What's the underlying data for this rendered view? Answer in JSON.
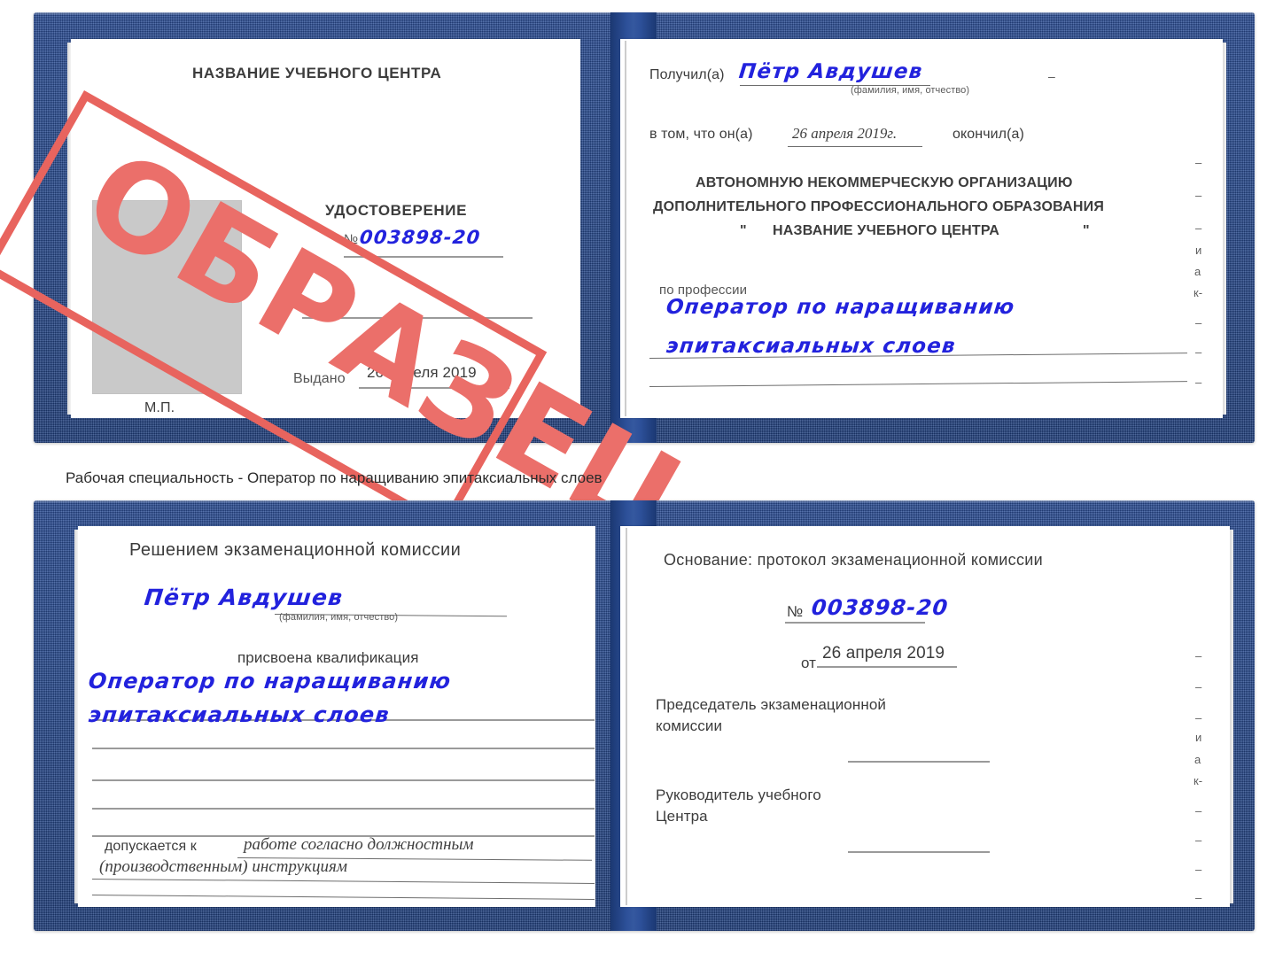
{
  "caption": "Рабочая специальность - Оператор по наращиванию эпитаксиальных слоев",
  "colors": {
    "cover_blue": "#274990",
    "spine_blue": "#1b3872",
    "ink_blue": "#2222dd",
    "stamp_red": "#e8645e",
    "rule_gray": "#9a9a9a",
    "photo_gray": "#c9c9c9"
  },
  "watermark": {
    "text": "ОБРАЗЕЦ",
    "name": "sample-watermark-stamp"
  },
  "certificate_top": {
    "name": "udostoverenie-spread",
    "left_page": {
      "org_title": "НАЗВАНИЕ УЧЕБНОГО ЦЕНТРА",
      "doc_type": "УДОСТОВЕРЕНИЕ",
      "number_label": "№",
      "number_value": "003898-20",
      "issued_label": "Выдано",
      "issued_value": "26 апреля 2019",
      "seal_label": "М.П.",
      "photo_placeholder": "photo-placeholder"
    },
    "right_page": {
      "received_label": "Получил(а)",
      "received_value": "Пётр Авдушев",
      "fio_hint": "(фамилия, имя, отчество)",
      "in_that_label": "в том, что он(а)",
      "completion_date": "26 апреля 2019г.",
      "finished_label": "окончил(а)",
      "org_line1": "АВТОНОМНУЮ НЕКОММЕРЧЕСКУЮ ОРГАНИЗАЦИЮ",
      "org_line2": "ДОПОЛНИТЕЛЬНОГО ПРОФЕССИОНАЛЬНОГО ОБРАЗОВАНИЯ",
      "org_quote_open": "\"",
      "org_line3": "НАЗВАНИЕ УЧЕБНОГО ЦЕНТРА",
      "org_quote_close": "\"",
      "profession_label": "по профессии",
      "profession_line1": "Оператор по наращиванию",
      "profession_line2": "эпитаксиальных слоев",
      "edge_fragments": [
        "–",
        "–",
        "–",
        "и",
        "а",
        "к-",
        "–",
        "–",
        "–"
      ]
    }
  },
  "certificate_bottom": {
    "name": "reshenie-spread",
    "left_page": {
      "heading": "Решением экзаменационной комиссии",
      "name_value": "Пётр Авдушев",
      "fio_hint": "(фамилия, имя, отчество)",
      "qualification_label": "присвоена квалификация",
      "qualification_line1": "Оператор по наращиванию",
      "qualification_line2": "эпитаксиальных слоев",
      "admitted_label": "допускается к",
      "admitted_line1": "работе согласно должностным",
      "admitted_line2": "(производственным) инструкциям"
    },
    "right_page": {
      "basis_label": "Основание: протокол экзаменационной комиссии",
      "number_label": "№",
      "number_value": "003898-20",
      "date_label": "от",
      "date_value": "26 апреля 2019",
      "chairman_line1": "Председатель экзаменационной",
      "chairman_line2": "комиссии",
      "head_line1": "Руководитель учебного",
      "head_line2": "Центра",
      "edge_fragments": [
        "–",
        "–",
        "–",
        "и",
        "а",
        "к-",
        "–",
        "–",
        "–",
        "–"
      ]
    }
  }
}
